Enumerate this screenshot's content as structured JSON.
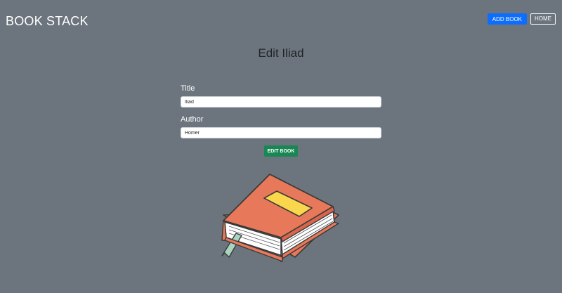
{
  "header": {
    "brand": "BOOK STACK",
    "add_book_label": "ADD BOOK",
    "home_label": "HOME"
  },
  "main": {
    "heading": "Edit Iliad",
    "title_label": "Title",
    "title_value": "Iliad",
    "author_label": "Author",
    "author_value": "Homer",
    "submit_label": "EDIT BOOK"
  },
  "colors": {
    "background": "#6c757d",
    "primary": "#0d6efd",
    "success": "#198754",
    "book_cover": "#e8785a",
    "book_label": "#f9d64c"
  },
  "icons": {
    "illustration": "book-illustration"
  }
}
